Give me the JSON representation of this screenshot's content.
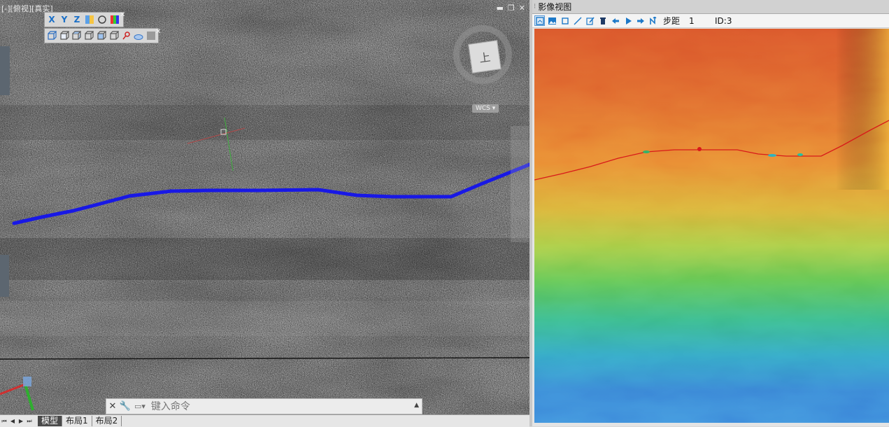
{
  "cad_view": {
    "view_label": "[-][俯视][真实]",
    "window_controls": {
      "minimize": "▬",
      "restore": "❐",
      "close": "✕"
    },
    "axis_toolbar": [
      "X",
      "Y",
      "Z"
    ],
    "wcs_label": "WCS ▾",
    "viewcube_face": "上",
    "command_line": {
      "placeholder": "键入命令",
      "close": "✕",
      "wrench": "🔧",
      "prompt": "▭▾",
      "expand": "▲"
    },
    "layout_tabs": [
      "模型",
      "布局1",
      "布局2"
    ],
    "active_tab": "模型",
    "nav_buttons": [
      "⏮",
      "◀",
      "▶",
      "⏭"
    ],
    "polyline_color": "#1a1af0"
  },
  "image_view": {
    "title": "影像视图",
    "toolbar": {
      "icons": [
        "zoom-extent-icon",
        "image-icon",
        "rectangle-select-icon",
        "measure-line-icon",
        "edit-icon",
        "delete-icon",
        "arrow-left-icon",
        "play-icon",
        "arrow-right-icon",
        "jump-icon"
      ],
      "step_label": "步距",
      "step_value": "1",
      "id_label": "ID:3"
    },
    "trace_color": "#d81a1a"
  }
}
